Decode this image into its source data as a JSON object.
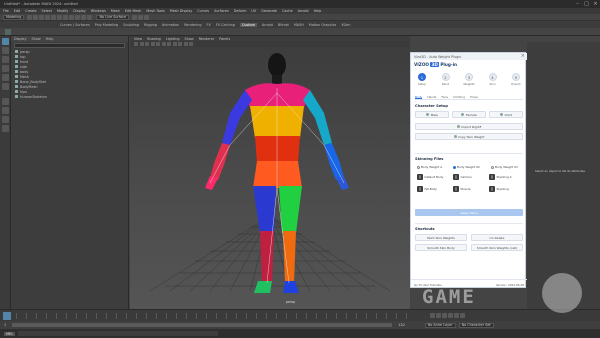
{
  "window": {
    "title": "Untitled* - Autodesk MAYA 2024: untitled"
  },
  "menubar": {
    "items": [
      "File",
      "Edit",
      "Create",
      "Select",
      "Modify",
      "Display",
      "Windows",
      "Mesh",
      "Edit Mesh",
      "Mesh Tools",
      "Mesh Display",
      "Curves",
      "Surfaces",
      "Deform",
      "UV",
      "Generate",
      "Cache",
      "Arnold",
      "Help"
    ]
  },
  "statusline": {
    "mode": "Modeling",
    "snap_text": "No Live Surface"
  },
  "shelf": {
    "tabs": [
      "Curves / Surfaces",
      "Poly Modeling",
      "Sculpting",
      "Rigging",
      "Animation",
      "Rendering",
      "FX",
      "FX Caching",
      "Custom",
      "Arnold",
      "Bifrost",
      "MASH",
      "Motion Graphics",
      "XGen"
    ],
    "active": "Custom"
  },
  "outliner": {
    "header": [
      "Display",
      "Show",
      "Help"
    ],
    "items": [
      "persp",
      "top",
      "front",
      "side",
      "body",
      "Mesh",
      "Bone_BodySkel",
      "BodyMesh",
      "hips",
      "HumanSkeleton"
    ]
  },
  "viewport": {
    "menu": [
      "View",
      "Shading",
      "Lighting",
      "Show",
      "Renderer",
      "Panels"
    ],
    "camera": "persp"
  },
  "plugin": {
    "window_title": "Vizo3D - Auto Weight Plugin",
    "product": "VIZOO",
    "tag": "3D",
    "suffix": "Plug-in",
    "steps": [
      {
        "label": "Setup",
        "num": "1"
      },
      {
        "label": "Paint",
        "num": "2"
      },
      {
        "label": "Weights",
        "num": "3"
      },
      {
        "label": "Skin",
        "num": "4"
      },
      {
        "label": "Export",
        "num": "5"
      }
    ],
    "subtabs": [
      "Body",
      "Hands",
      "Face",
      "Clothing",
      "Props"
    ],
    "character_setup": {
      "title": "Character Setup",
      "options": [
        "Male",
        "Female",
        "Child"
      ],
      "import_btn": "Import Rig/SF",
      "copy_btn": "Copy Skin Weight"
    },
    "skinning": {
      "title": "Skinning Files",
      "radios": [
        "Body Weight A",
        "Body Weight 02",
        "Body Weight 03"
      ],
      "thumbs": [
        "Default Body",
        "Cartoon",
        "Stylizing 2",
        "Fat Body",
        "Muscle",
        "Stylizing"
      ],
      "apply_btn": "Apply Skins"
    },
    "shortcuts": {
      "title": "Shortcuts",
      "buttons": [
        "Paint Skin Weights",
        "Un Delete",
        "Smooth Skin Body",
        "Smooth Skin Weights (cell)"
      ]
    },
    "footer": {
      "left": "Go To User Tutorials",
      "right": "Version: 2024.06.28"
    }
  },
  "right_panel": {
    "note": "Select an object to list its attributes"
  },
  "timeline": {
    "start": "1",
    "end": "120",
    "anim_layer": "No Anim Layer",
    "char_set": "No Character Set"
  },
  "command_line": {
    "lang": "MEL"
  },
  "watermark": "GAME"
}
